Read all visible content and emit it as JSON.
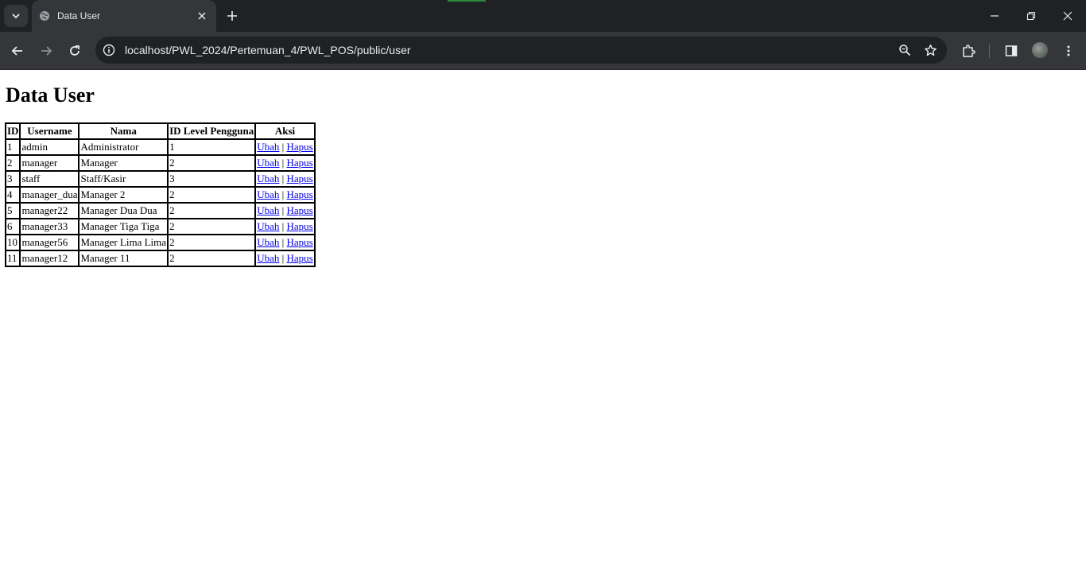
{
  "browser": {
    "tab_title": "Data User",
    "url": "localhost/PWL_2024/Pertemuan_4/PWL_POS/public/user"
  },
  "page": {
    "heading": "Data User",
    "table": {
      "headers": [
        "ID",
        "Username",
        "Nama",
        "ID Level Pengguna",
        "Aksi"
      ],
      "rows": [
        {
          "id": "1",
          "username": "admin",
          "nama": "Administrator",
          "level": "1"
        },
        {
          "id": "2",
          "username": "manager",
          "nama": "Manager",
          "level": "2"
        },
        {
          "id": "3",
          "username": "staff",
          "nama": "Staff/Kasir",
          "level": "3"
        },
        {
          "id": "4",
          "username": "manager_dua",
          "nama": "Manager 2",
          "level": "2"
        },
        {
          "id": "5",
          "username": "manager22",
          "nama": "Manager Dua Dua",
          "level": "2"
        },
        {
          "id": "6",
          "username": "manager33",
          "nama": "Manager Tiga Tiga",
          "level": "2"
        },
        {
          "id": "10",
          "username": "manager56",
          "nama": "Manager Lima Lima",
          "level": "2"
        },
        {
          "id": "11",
          "username": "manager12",
          "nama": "Manager 11",
          "level": "2"
        }
      ],
      "action_edit": "Ubah",
      "action_separator": "|",
      "action_delete": "Hapus"
    }
  }
}
